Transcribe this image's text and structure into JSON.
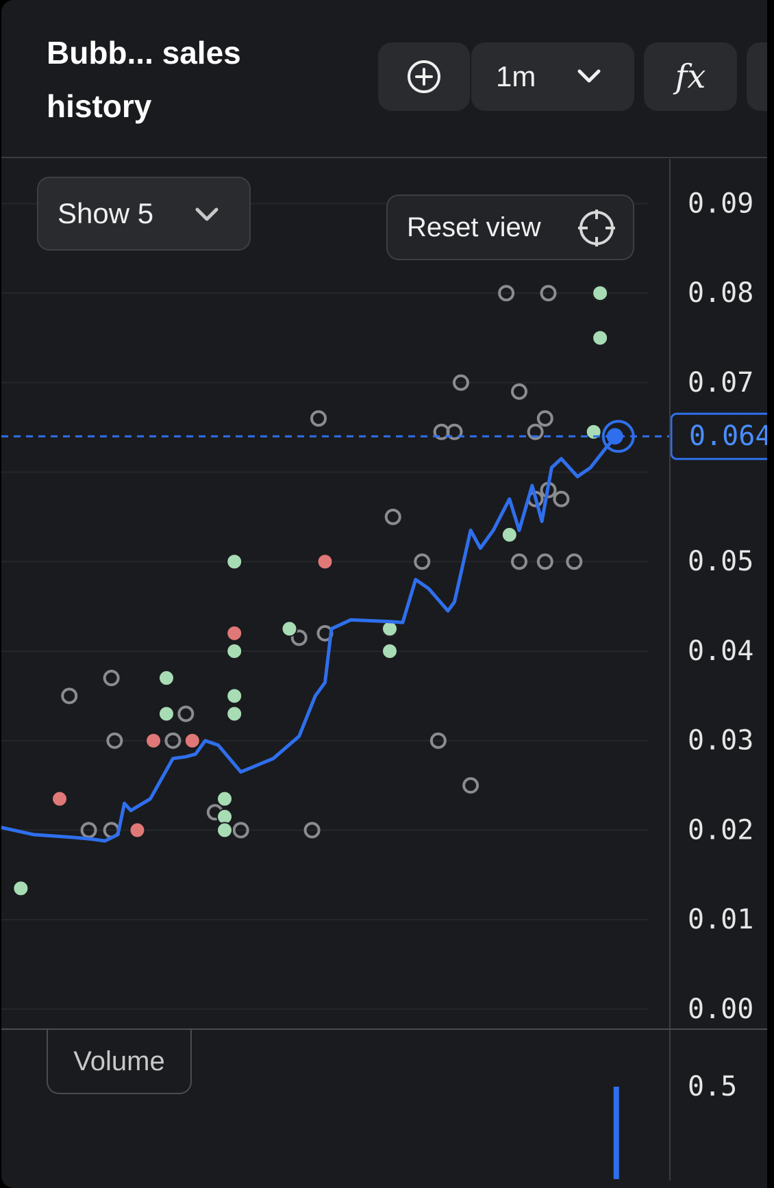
{
  "header": {
    "title": "Bubb... sales history",
    "range_label": "1m",
    "fx_label": "fx"
  },
  "controls": {
    "show_label": "Show 5",
    "reset_label": "Reset view",
    "volume_label": "Volume"
  },
  "colors": {
    "background": "#1a1b1e",
    "line": "#2f6fed",
    "buy": "#a8dcb4",
    "sell": "#e07878",
    "listing": "#8a8c90"
  },
  "chart_data": {
    "type": "scatter",
    "y_axis": {
      "ticks": [
        "0.09",
        "0.08",
        "0.07",
        "0.05",
        "0.04",
        "0.03",
        "0.02",
        "0.01",
        "0.00"
      ],
      "tick_values": [
        0.09,
        0.08,
        0.07,
        0.05,
        0.04,
        0.03,
        0.02,
        0.01,
        0.0
      ],
      "range": [
        -0.002,
        0.095
      ],
      "position": "right"
    },
    "x_range": [
      0,
      1
    ],
    "current_value_label": "0.064",
    "current_value": 0.064,
    "grid": true,
    "series": [
      {
        "kind": "line",
        "points": [
          [
            0.0,
            0.0203
          ],
          [
            0.05,
            0.0195
          ],
          [
            0.11,
            0.0192
          ],
          [
            0.14,
            0.019
          ],
          [
            0.16,
            0.0188
          ],
          [
            0.18,
            0.0195
          ],
          [
            0.19,
            0.023
          ],
          [
            0.2,
            0.0222
          ],
          [
            0.23,
            0.0235
          ],
          [
            0.265,
            0.028
          ],
          [
            0.285,
            0.0282
          ],
          [
            0.3,
            0.0285
          ],
          [
            0.315,
            0.03
          ],
          [
            0.335,
            0.0295
          ],
          [
            0.37,
            0.0265
          ],
          [
            0.42,
            0.028
          ],
          [
            0.46,
            0.0305
          ],
          [
            0.485,
            0.035
          ],
          [
            0.5,
            0.0365
          ],
          [
            0.51,
            0.0425
          ],
          [
            0.54,
            0.0435
          ],
          [
            0.6,
            0.0433
          ],
          [
            0.62,
            0.0432
          ],
          [
            0.64,
            0.048
          ],
          [
            0.66,
            0.047
          ],
          [
            0.69,
            0.0445
          ],
          [
            0.7,
            0.0455
          ],
          [
            0.725,
            0.0535
          ],
          [
            0.74,
            0.0515
          ],
          [
            0.76,
            0.0535
          ],
          [
            0.785,
            0.057
          ],
          [
            0.8,
            0.0535
          ],
          [
            0.82,
            0.0585
          ],
          [
            0.835,
            0.0545
          ],
          [
            0.85,
            0.0605
          ],
          [
            0.865,
            0.0615
          ],
          [
            0.89,
            0.0595
          ],
          [
            0.91,
            0.0605
          ],
          [
            0.935,
            0.0628
          ],
          [
            0.95,
            0.064
          ]
        ]
      },
      {
        "kind": "listing",
        "points": [
          [
            0.105,
            0.035
          ],
          [
            0.17,
            0.037
          ],
          [
            0.175,
            0.03
          ],
          [
            0.135,
            0.02
          ],
          [
            0.17,
            0.02
          ],
          [
            0.285,
            0.033
          ],
          [
            0.265,
            0.03
          ],
          [
            0.37,
            0.02
          ],
          [
            0.33,
            0.022
          ],
          [
            0.48,
            0.02
          ],
          [
            0.46,
            0.0415
          ],
          [
            0.5,
            0.042
          ],
          [
            0.49,
            0.066
          ],
          [
            0.6,
            0.0425
          ],
          [
            0.605,
            0.055
          ],
          [
            0.65,
            0.05
          ],
          [
            0.675,
            0.03
          ],
          [
            0.725,
            0.025
          ],
          [
            0.71,
            0.07
          ],
          [
            0.7,
            0.0645
          ],
          [
            0.68,
            0.0645
          ],
          [
            0.78,
            0.08
          ],
          [
            0.8,
            0.069
          ],
          [
            0.825,
            0.0645
          ],
          [
            0.84,
            0.066
          ],
          [
            0.845,
            0.08
          ],
          [
            0.8,
            0.05
          ],
          [
            0.84,
            0.05
          ],
          [
            0.885,
            0.05
          ],
          [
            0.825,
            0.057
          ],
          [
            0.845,
            0.058
          ],
          [
            0.865,
            0.057
          ],
          [
            0.925,
            0.08
          ]
        ]
      },
      {
        "kind": "buy",
        "points": [
          [
            0.03,
            0.0135
          ],
          [
            0.255,
            0.037
          ],
          [
            0.255,
            0.033
          ],
          [
            0.36,
            0.05
          ],
          [
            0.36,
            0.04
          ],
          [
            0.36,
            0.035
          ],
          [
            0.36,
            0.033
          ],
          [
            0.345,
            0.0235
          ],
          [
            0.345,
            0.0215
          ],
          [
            0.345,
            0.02
          ],
          [
            0.445,
            0.0425
          ],
          [
            0.6,
            0.0425
          ],
          [
            0.6,
            0.04
          ],
          [
            0.785,
            0.053
          ],
          [
            0.915,
            0.0645
          ],
          [
            0.925,
            0.08
          ],
          [
            0.925,
            0.075
          ]
        ]
      },
      {
        "kind": "sell",
        "points": [
          [
            0.09,
            0.0235
          ],
          [
            0.21,
            0.02
          ],
          [
            0.235,
            0.03
          ],
          [
            0.295,
            0.03
          ],
          [
            0.36,
            0.042
          ],
          [
            0.5,
            0.05
          ]
        ]
      }
    ],
    "volume": {
      "tick_label": "0.5",
      "tick_value": 0.5,
      "bars": [
        [
          0.95,
          0.5
        ]
      ]
    }
  }
}
